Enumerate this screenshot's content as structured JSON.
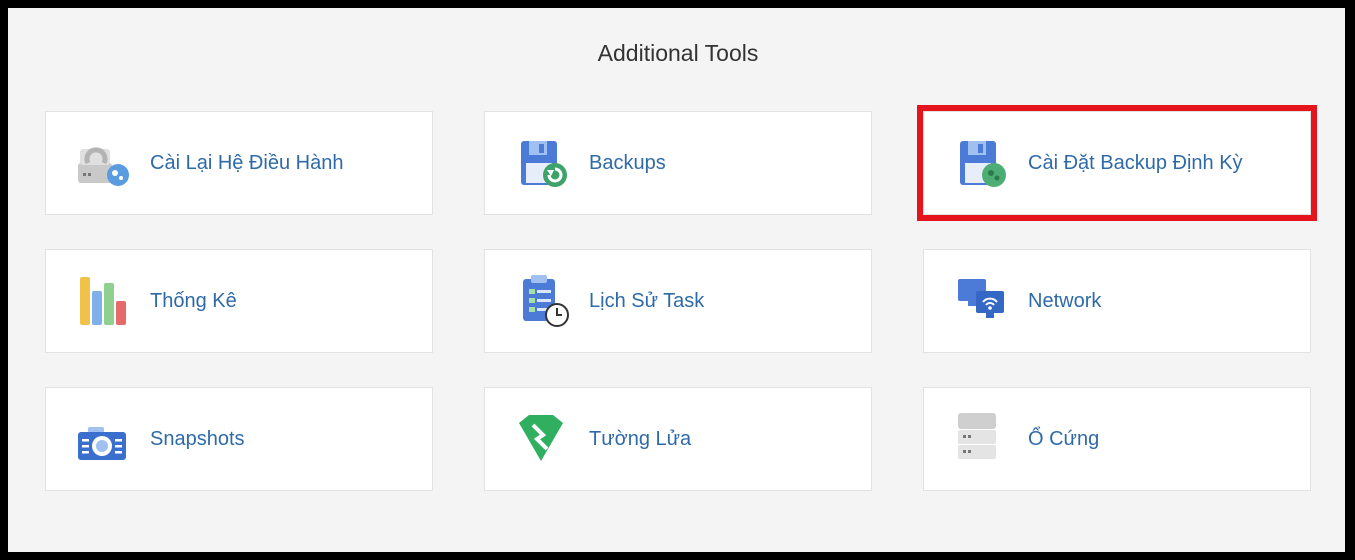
{
  "section": {
    "title": "Additional Tools"
  },
  "tiles": [
    {
      "label": "Cài Lại Hệ Điều Hành",
      "icon": "os-reinstall-icon"
    },
    {
      "label": "Backups",
      "icon": "backup-restore-icon"
    },
    {
      "label": "Cài Đặt Backup Định Kỳ",
      "icon": "backup-schedule-icon",
      "highlighted": true
    },
    {
      "label": "Thống Kê",
      "icon": "statistics-chart-icon"
    },
    {
      "label": "Lịch Sử Task",
      "icon": "task-history-icon"
    },
    {
      "label": "Network",
      "icon": "network-icon"
    },
    {
      "label": "Snapshots",
      "icon": "snapshot-camera-icon"
    },
    {
      "label": "Tường Lửa",
      "icon": "firewall-icon"
    },
    {
      "label": "Ổ Cứng",
      "icon": "hard-disk-icon"
    }
  ],
  "colors": {
    "highlight_border": "#e3141c",
    "label_text": "#2f6aa8",
    "panel_bg": "#f4f4f4"
  }
}
